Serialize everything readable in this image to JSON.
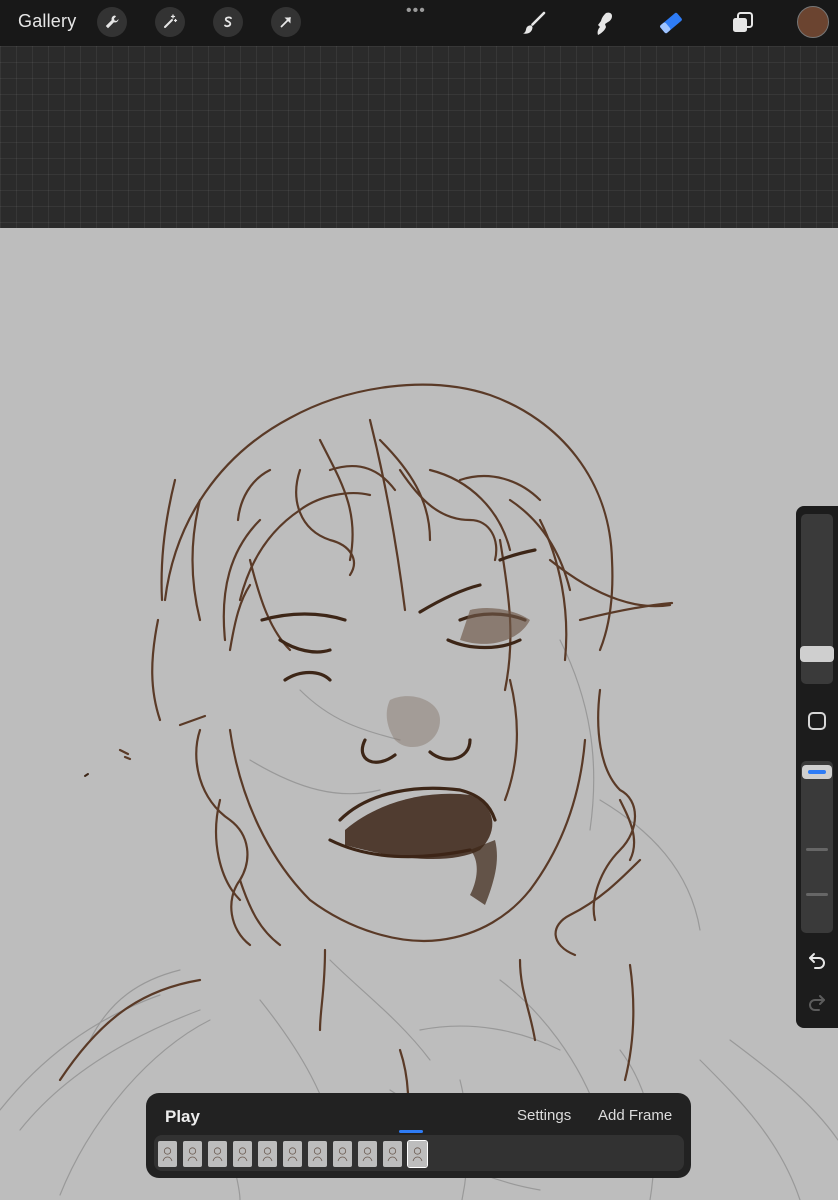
{
  "toolbar": {
    "gallery_label": "Gallery",
    "left_tools": [
      "wrench-icon",
      "magic-wand-icon",
      "selection-s-icon",
      "transform-arrow-icon"
    ],
    "more_label": "•••",
    "right_tools": [
      "brush-icon",
      "smudge-icon",
      "eraser-icon",
      "layers-icon"
    ],
    "active_tool": "eraser-icon",
    "color": "#6b4430"
  },
  "colors": {
    "accent": "#2e7cf6",
    "stroke": "#5a3a27",
    "canvas": "#bdbdbd"
  },
  "sidebar": {
    "brush_size": 0.17,
    "opacity": 0.92,
    "undo_icon": "undo-icon",
    "redo_icon": "redo-icon"
  },
  "animation": {
    "play_label": "Play",
    "settings_label": "Settings",
    "add_frame_label": "Add Frame",
    "frame_count": 11,
    "selected_frame": 11
  }
}
